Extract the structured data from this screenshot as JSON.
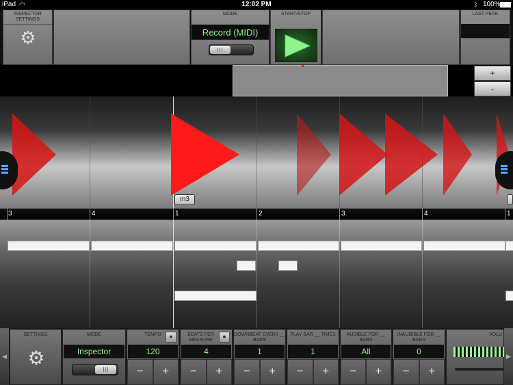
{
  "status_bar": {
    "device": "iPad",
    "time": "12:02 PM",
    "battery": "100%"
  },
  "top": {
    "inspector_settings_label": "INSPECTOR SETTINGS",
    "mode_label": "MODE",
    "mode_value": "Record (MIDI)",
    "start_stop_label": "START/STOP",
    "last_peak_label": "LAST PEAK",
    "plus_label": "+",
    "minus_label": "-"
  },
  "timeline": {
    "beats": [
      "3",
      "4",
      "1",
      "2",
      "3",
      "4",
      "1"
    ],
    "tooltip": "m3"
  },
  "bottom": {
    "settings_label": "SETTINGS",
    "mode_label": "MODE",
    "mode_value": "Inspector",
    "tempo_label": "TEMPO",
    "tempo_value": "120",
    "beats_per_measure_label": "BEATS PER MEASURE",
    "beats_per_measure_value": "4",
    "downbeat_label": "DOWNBEAT EVERY __ BARS",
    "downbeat_value": "1",
    "play_bar_label": "PLAY BAR __ TIMES",
    "play_bar_value": "1",
    "audible_label": "AUDIBLE FOR __ BARS",
    "audible_value": "All",
    "inaudible_label": "INAUDIBLE FOR __ BARS",
    "inaudible_value": "0",
    "volume_label": "VOLU",
    "minus": "−",
    "plus": "+"
  },
  "colors": {
    "lcd_text": "#8cf78c",
    "arrow": "#e01010",
    "play": "#8ef58e"
  }
}
